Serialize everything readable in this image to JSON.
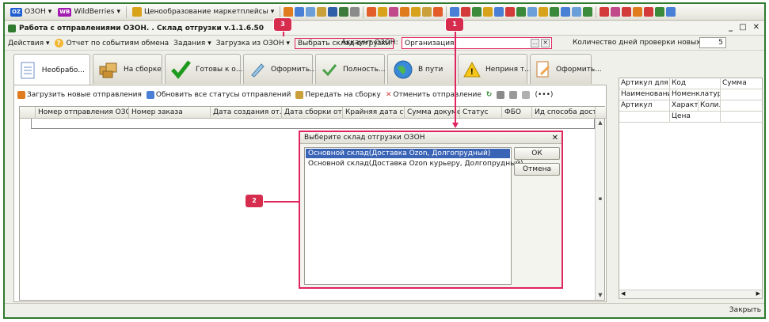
{
  "toolbar": {
    "ozon_label": "ОЗОН",
    "wb_label": "WildBerries",
    "pricing_label": "Ценообразование маркетплейсы",
    "ozon_badge": "OZ",
    "wb_badge": "WB"
  },
  "window": {
    "title": "Работа с отправлениями ОЗОН. . Склад отгрузки  v.1.1.6.50",
    "minimize": "_",
    "maximize": "□",
    "close": "✕"
  },
  "actions": {
    "actions_menu": "Действия",
    "report_label": "Отчет по событиям обмена",
    "tasks_menu": "Задания",
    "load_menu": "Загрузка из ОЗОН",
    "select_warehouse": "Выбрать склад отгрузки",
    "account_label": "Аккаунт ОЗОН:",
    "account_value": "Организация",
    "days_label": "Количество дней проверки новых:",
    "days_value": "5"
  },
  "tabs": [
    {
      "label": "Необрабо..."
    },
    {
      "label": "На сборке"
    },
    {
      "label": "Готовы к о..."
    },
    {
      "label": "Оформить..."
    },
    {
      "label": "Полность..."
    },
    {
      "label": "В пути"
    },
    {
      "label": "Неприня т..."
    },
    {
      "label": "Оформить..."
    }
  ],
  "commands": {
    "load_new": "Загрузить новые отправления",
    "update_statuses": "Обновить все статусы отправлений",
    "pass_assembly": "Передать на сборку",
    "cancel_shipment": "Отменить отправление",
    "extra": "(•••)"
  },
  "grid": {
    "columns": [
      "Номер отправления ОЗОН",
      "Номер заказа",
      "Дата создания от...",
      "Дата сборки отпр...",
      "Крайняя дата сбо...",
      "Сумма докумен...",
      "Статус",
      "ФБО",
      "Ид способа доста..."
    ]
  },
  "right_pane": {
    "rows": [
      [
        "Артикул для О...",
        "Код",
        "Сумма"
      ],
      [
        "Наименовани...",
        "Номенклатура",
        ""
      ],
      [
        "Артикул",
        "Характ...",
        "Коли..."
      ],
      [
        "",
        "Цена",
        ""
      ]
    ]
  },
  "dialog": {
    "title": "Выберите склад отгрузки ОЗОН",
    "close": "✕",
    "items": [
      "Основной склад(Доставка Ozon, Долгопрудный)",
      "Основной склад(Доставка Ozon курьеру, Долгопрудный)"
    ],
    "ok_label": "ОК",
    "cancel_label": "Отмена"
  },
  "status": {
    "close_label": "Закрыть"
  },
  "markers": {
    "m1": "1",
    "m2": "2",
    "m3": "3"
  },
  "colors": {
    "highlight": "#e0245e",
    "frame": "#2f7a2f",
    "selection": "#3a64b5"
  }
}
